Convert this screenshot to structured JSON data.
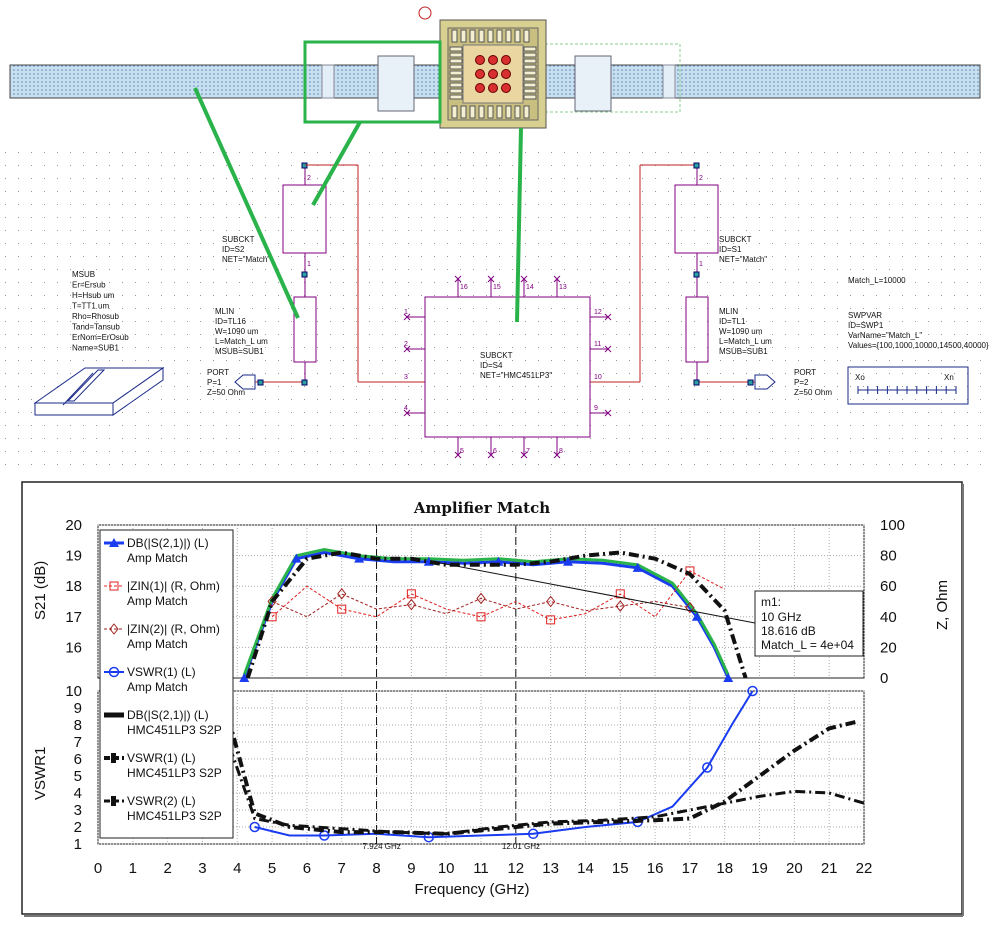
{
  "schematic": {
    "msub": [
      "MSUB",
      "Er=Ersub",
      "H=Hsub um",
      "T=TT1 um",
      "Rho=Rhosub",
      "Tand=Tansub",
      "ErNom=ErOsub",
      "Name=SUB1"
    ],
    "subckt_s2": [
      "SUBCKT",
      "ID=S2",
      "NET=\"Match\""
    ],
    "subckt_s1": [
      "SUBCKT",
      "ID=S1",
      "NET=\"Match\""
    ],
    "mlin_tl16": [
      "MLIN",
      "ID=TL16",
      "W=1090 um",
      "L=Match_L um",
      "MSUB=SUB1"
    ],
    "mlin_tl1": [
      "MLIN",
      "ID=TL1",
      "W=1090 um",
      "L=Match_L um",
      "MSUB=SUB1"
    ],
    "port1": [
      "PORT",
      "P=1",
      "Z=50 Ohm"
    ],
    "port2": [
      "PORT",
      "P=2",
      "Z=50 Ohm"
    ],
    "subckt_s4": [
      "SUBCKT",
      "ID=S4",
      "NET=\"HMC451LP3\""
    ],
    "eq_match": "Match_L=10000",
    "swpvar": [
      "SWPVAR",
      "ID=SWP1",
      "VarName=\"Match_L\"",
      "Values={100,1000,10000,14500,40000}"
    ],
    "swp_xo": "Xo",
    "swp_xn": "Xn",
    "pins": [
      "1",
      "2",
      "3",
      "4",
      "5",
      "6",
      "7",
      "8",
      "9",
      "10",
      "11",
      "12",
      "13",
      "14",
      "15",
      "16"
    ],
    "small_pins": [
      "1",
      "2"
    ]
  },
  "chart_data": [
    {
      "type": "line",
      "title": "Amplifier Match",
      "xlabel": "Frequency (GHz)",
      "ylabel": "S21 (dB)",
      "y2label": "Z, Ohm",
      "ylim": [
        15,
        20
      ],
      "y2lim": [
        0,
        100
      ],
      "xlim": [
        0,
        22
      ],
      "xticks": [
        "0",
        "1",
        "2",
        "3",
        "4",
        "5",
        "6",
        "7",
        "8",
        "9",
        "10",
        "11",
        "12",
        "13",
        "14",
        "15",
        "16",
        "17",
        "18",
        "19",
        "20",
        "21",
        "22"
      ],
      "yticks": [
        "20",
        "19",
        "18",
        "17",
        "16"
      ],
      "y2ticks": [
        "100",
        "80",
        "60",
        "40",
        "20",
        "0"
      ],
      "series": [
        {
          "name": "DB(|S(2,1)|) (L) Amp Match",
          "color": "#1a3cf0",
          "x": [
            4.2,
            5,
            5.7,
            6.5,
            7.5,
            8.5,
            9.5,
            10.5,
            11.5,
            12.5,
            13.5,
            14.5,
            15.5,
            16.5,
            17.2,
            17.7,
            18.1
          ],
          "y": [
            15,
            17.5,
            18.9,
            19.1,
            18.9,
            18.8,
            18.8,
            18.75,
            18.8,
            18.7,
            18.8,
            18.75,
            18.6,
            18.0,
            17.0,
            16.0,
            15.0
          ]
        },
        {
          "name": "|ZIN(1)| (R, Ohm) Amp Match",
          "color": "#e02020",
          "x": [
            5,
            6,
            7,
            8,
            9,
            10,
            11,
            12,
            13,
            14,
            15,
            16,
            17,
            18
          ],
          "y": [
            40,
            60,
            45,
            40,
            55,
            45,
            40,
            50,
            38,
            42,
            55,
            40,
            70,
            58
          ]
        },
        {
          "name": "|ZIN(2)| (R, Ohm) Amp Match",
          "color": "#a02020",
          "x": [
            5,
            6,
            7,
            8,
            9,
            10,
            11,
            12,
            13,
            14,
            15,
            16,
            17
          ],
          "y": [
            50,
            40,
            55,
            45,
            48,
            42,
            52,
            45,
            50,
            44,
            47,
            50,
            46
          ]
        },
        {
          "name": "VSWR(1) (L) Amp Match",
          "color": "#1a3cf0",
          "x": [
            4.5,
            5.5,
            6.5,
            8,
            9.5,
            11,
            12.5,
            14,
            15.5,
            16.5,
            17.5,
            18.2,
            18.8
          ],
          "y": [
            2.0,
            1.5,
            1.5,
            1.6,
            1.4,
            1.5,
            1.6,
            2.0,
            2.3,
            3.2,
            5.5,
            8.0,
            10
          ]
        },
        {
          "name": "DB(|S(2,1)|) (L) HMC451LP3 S2P",
          "color": "#111111",
          "x": [
            4.3,
            5,
            6,
            7,
            8,
            9,
            10,
            11,
            12,
            13,
            14,
            15,
            16,
            17,
            18,
            18.6
          ],
          "y": [
            15,
            17.5,
            18.9,
            19.1,
            18.9,
            18.9,
            18.7,
            18.7,
            18.7,
            18.8,
            19.0,
            19.1,
            18.9,
            18.4,
            17.2,
            15.0
          ]
        },
        {
          "name": "VSWR(1) (L) HMC451LP3 S2P",
          "color": "#111111",
          "x": [
            3.6,
            4.5,
            5.5,
            7,
            8.5,
            10,
            11.5,
            13,
            14.5,
            16,
            17,
            18,
            19,
            20,
            21,
            21.8
          ],
          "y": [
            9.5,
            2.8,
            2.0,
            1.7,
            1.7,
            1.6,
            1.9,
            2.2,
            2.3,
            2.4,
            2.5,
            3.5,
            5.0,
            6.5,
            7.8,
            8.2
          ]
        },
        {
          "name": "VSWR(2) (L) HMC451LP3 S2P",
          "color": "#111111",
          "x": [
            3.6,
            4.5,
            5.5,
            7,
            8.5,
            10,
            11.5,
            13,
            14.5,
            16,
            17,
            18,
            19,
            20,
            21,
            22
          ],
          "y": [
            7.8,
            2.5,
            2.1,
            1.9,
            1.7,
            1.6,
            2.0,
            2.3,
            2.4,
            2.6,
            3.0,
            3.4,
            3.8,
            4.1,
            4.0,
            3.4
          ]
        }
      ],
      "marker": {
        "label": "m1:",
        "lines": [
          "10 GHz",
          "18.616 dB",
          "Match_L = 4e+04"
        ]
      },
      "annotations": [
        "7.924 GHz",
        "12.01 GHz"
      ]
    },
    {
      "type": "line",
      "ylabel": "VSWR1",
      "ylim": [
        1,
        10
      ],
      "yticks": [
        "10",
        "9",
        "8",
        "7",
        "6",
        "5",
        "4",
        "3",
        "2",
        "1"
      ]
    }
  ]
}
